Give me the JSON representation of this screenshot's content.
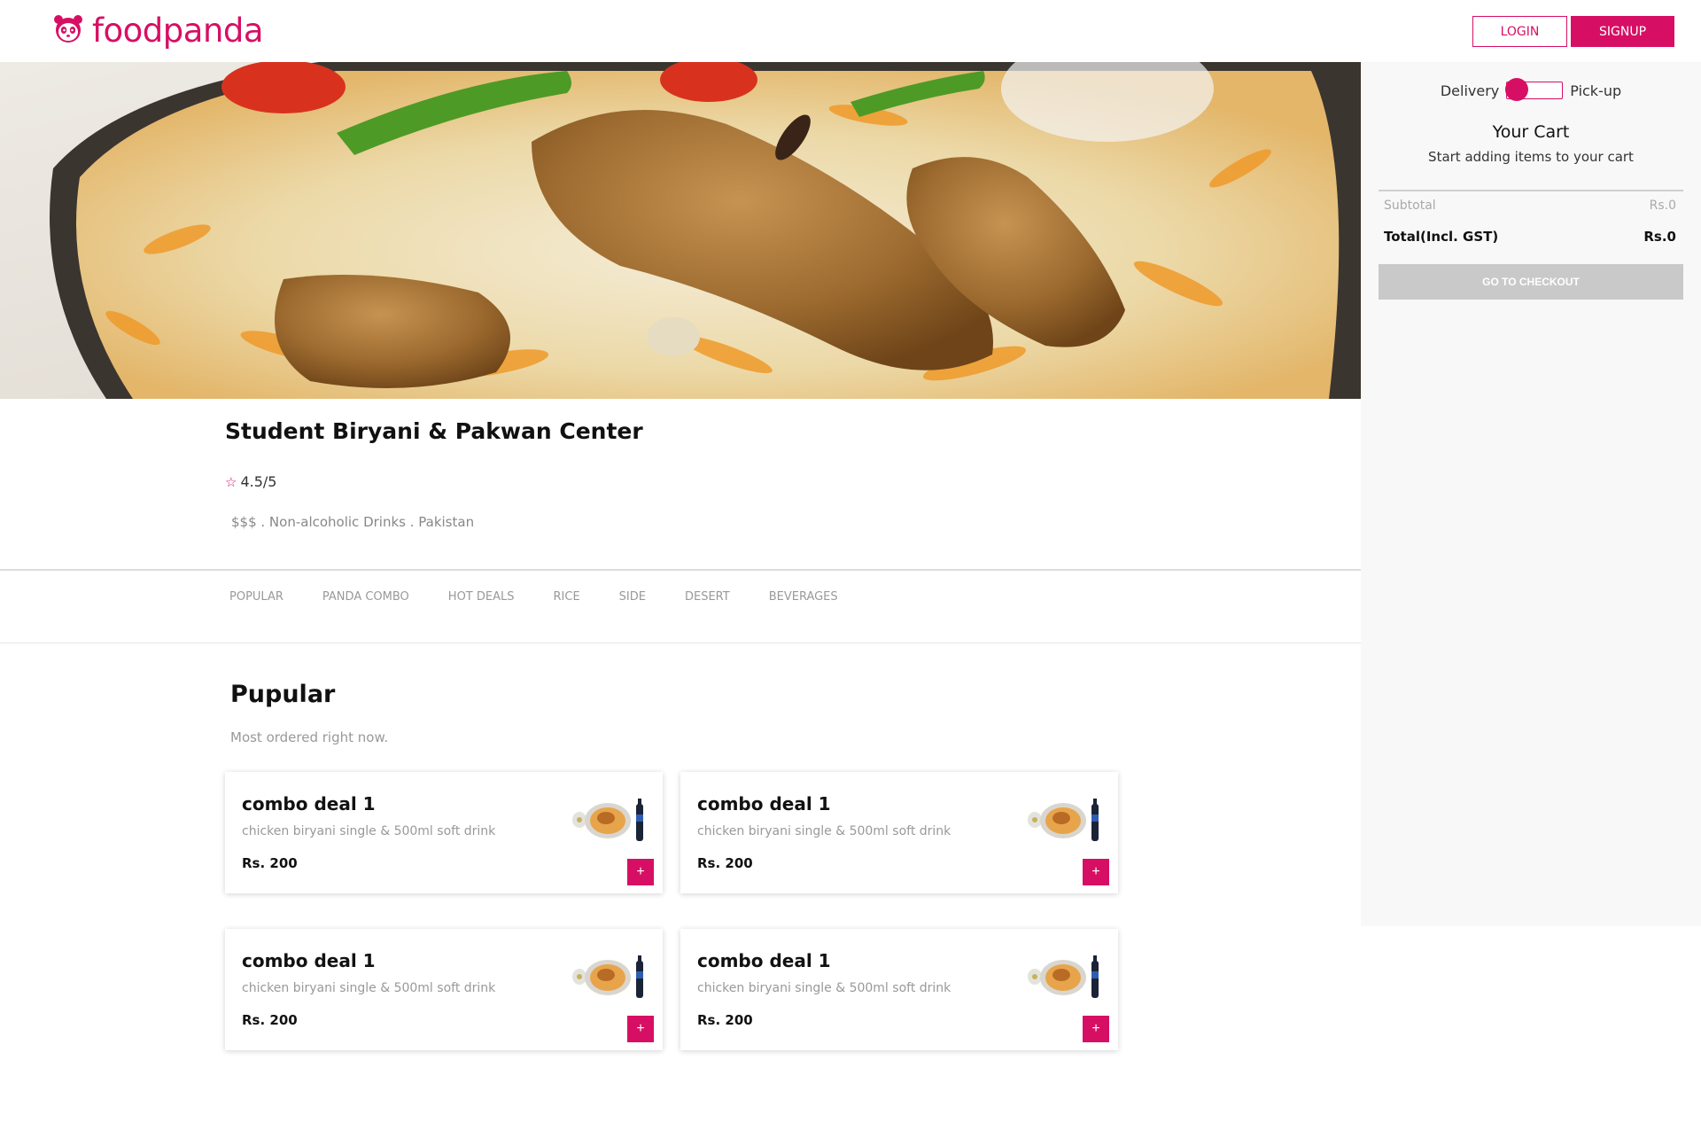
{
  "brand": {
    "name": "foodpanda",
    "color": "#d70f64",
    "logo_icon": "panda-icon"
  },
  "header": {
    "login_label": "LOGIN",
    "signup_label": "SIGNUP"
  },
  "restaurant": {
    "name": "Student Biryani & Pakwan Center",
    "rating": "4.5/5",
    "meta": "$$$ . Non-alcoholic Drinks . Pakistan"
  },
  "tabs": [
    "POPULAR",
    "PANDA COMBO",
    "HOT DEALS",
    "RICE",
    "SIDE",
    "DESERT",
    "BEVERAGES"
  ],
  "section": {
    "title": "Pupular",
    "subtitle": "Most ordered right now."
  },
  "items": [
    {
      "title": "combo deal 1",
      "description": "chicken biryani single & 500ml soft drink",
      "price": "Rs. 200",
      "add_label": "+"
    },
    {
      "title": "combo deal 1",
      "description": "chicken biryani single & 500ml soft drink",
      "price": "Rs. 200",
      "add_label": "+"
    },
    {
      "title": "combo deal 1",
      "description": "chicken biryani single & 500ml soft drink",
      "price": "Rs. 200",
      "add_label": "+"
    },
    {
      "title": "combo deal 1",
      "description": "chicken biryani single & 500ml soft drink",
      "price": "Rs. 200",
      "add_label": "+"
    }
  ],
  "cart": {
    "delivery_label": "Delivery",
    "pickup_label": "Pick-up",
    "mode": "Delivery",
    "title": "Your Cart",
    "subtitle": "Start adding items to your cart",
    "subtotal_label": "Subtotal",
    "subtotal_value": "Rs.0",
    "total_label": "Total(Incl. GST)",
    "total_value": "Rs.0",
    "checkout_label": "GO TO CHECKOUT"
  }
}
